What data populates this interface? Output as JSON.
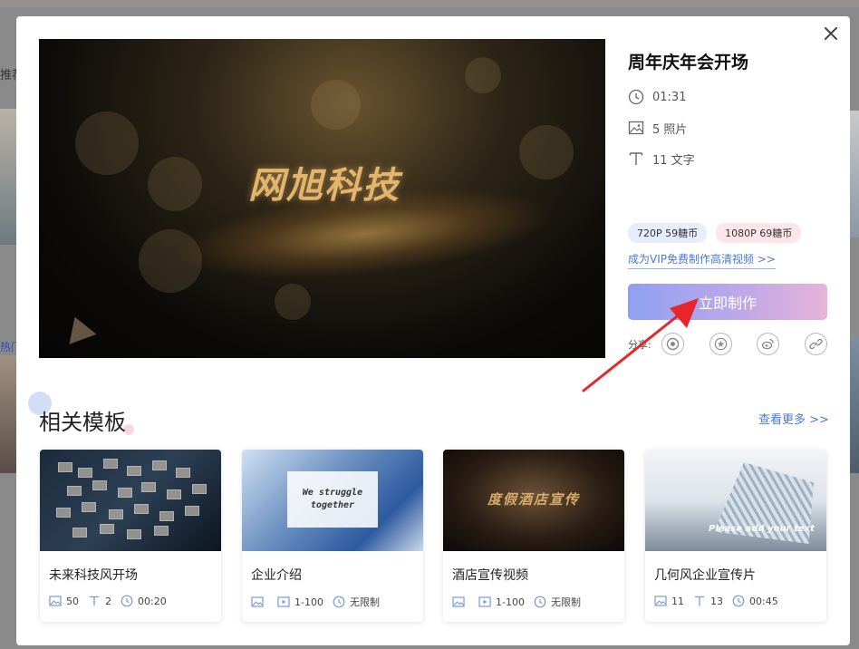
{
  "background": {
    "left_text": "推荐",
    "left_hot": "热门"
  },
  "modal": {
    "title": "周年庆年会开场",
    "preview_art_text": "网旭科技",
    "meta": {
      "duration": "01:31",
      "photos": "5 照片",
      "texts": "11 文字"
    },
    "prices": {
      "p720": "720P 59糖币",
      "p1080": "1080P 69糖币"
    },
    "vip_link": "成为VIP免费制作高清视频 >>",
    "make_button": "立即制作",
    "share_label": "分享:",
    "share_icons": [
      "qq-icon",
      "star-icon",
      "weibo-icon",
      "link-icon"
    ]
  },
  "related": {
    "heading": "相关模板",
    "more_link": "查看更多 >>",
    "cards": [
      {
        "name": "未来科技风开场",
        "thumb_text": "",
        "meta": [
          {
            "icon": "image-icon",
            "value": "50"
          },
          {
            "icon": "text-icon",
            "value": "2"
          },
          {
            "icon": "clock-icon",
            "value": "00:20"
          }
        ]
      },
      {
        "name": "企业介绍",
        "thumb_text": "We struggle together",
        "meta": [
          {
            "icon": "image-icon",
            "value": ""
          },
          {
            "icon": "video-icon",
            "value": "1-100"
          },
          {
            "icon": "clock-icon",
            "value": "无限制"
          }
        ]
      },
      {
        "name": "酒店宣传视频",
        "thumb_text": "度假酒店宣传",
        "meta": [
          {
            "icon": "image-icon",
            "value": ""
          },
          {
            "icon": "video-icon",
            "value": "1-100"
          },
          {
            "icon": "clock-icon",
            "value": "无限制"
          }
        ]
      },
      {
        "name": "几何风企业宣传片",
        "thumb_text": "Please add your text",
        "meta": [
          {
            "icon": "image-icon",
            "value": "11"
          },
          {
            "icon": "text-icon",
            "value": "13"
          },
          {
            "icon": "clock-icon",
            "value": "00:45"
          }
        ]
      }
    ]
  },
  "colors": {
    "accent_link": "#4a78d4",
    "button_gradient_start": "#8fa0f2",
    "button_gradient_end": "#e6b4d8",
    "arrow": "#e8262a"
  }
}
